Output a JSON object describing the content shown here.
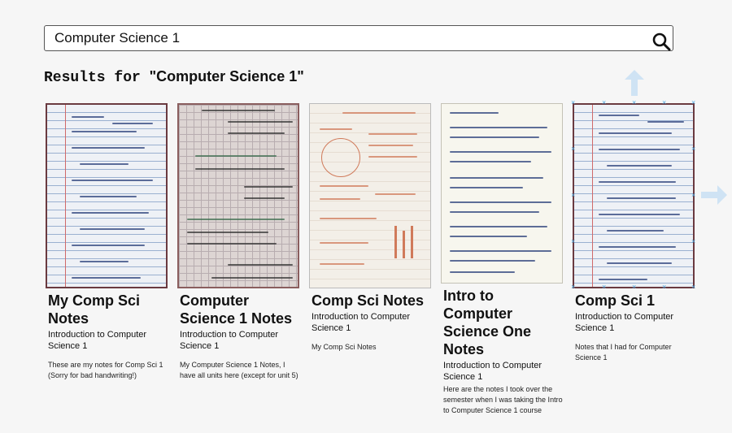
{
  "search": {
    "value": "Computer Science 1"
  },
  "results": {
    "prefix": "Results for ",
    "query_quoted": "\"Computer Science 1\""
  },
  "cards": [
    {
      "title": "My Comp Sci Notes",
      "subtitle": "Introduction to Computer Science 1",
      "description": "These are my notes for Comp Sci 1 (Sorry for bad handwriting!)"
    },
    {
      "title": "Computer Science 1 Notes",
      "subtitle": "Introduction to Computer Science 1",
      "description": "My Computer Science 1 Notes, I have all units here (except for unit 5)"
    },
    {
      "title": "Comp Sci Notes",
      "subtitle": "Introduction to Computer Science 1",
      "description": "My Comp Sci Notes"
    },
    {
      "title": "Intro to Computer Science One Notes",
      "subtitle": "Introduction to Computer Science 1",
      "description": "Here are the notes I took over the semester when I was taking the Intro to Computer Science 1 course"
    },
    {
      "title": "Comp Sci 1",
      "subtitle": "Introduction to Computer Science 1",
      "description": "Notes that I had for Computer Science 1"
    }
  ],
  "icons": {
    "search": "magnifier-icon",
    "move_up": "arrow-up-icon",
    "move_right": "arrow-right-icon"
  },
  "colors": {
    "background": "#f6f6f6",
    "selection_handles": "#4ea8e0"
  }
}
